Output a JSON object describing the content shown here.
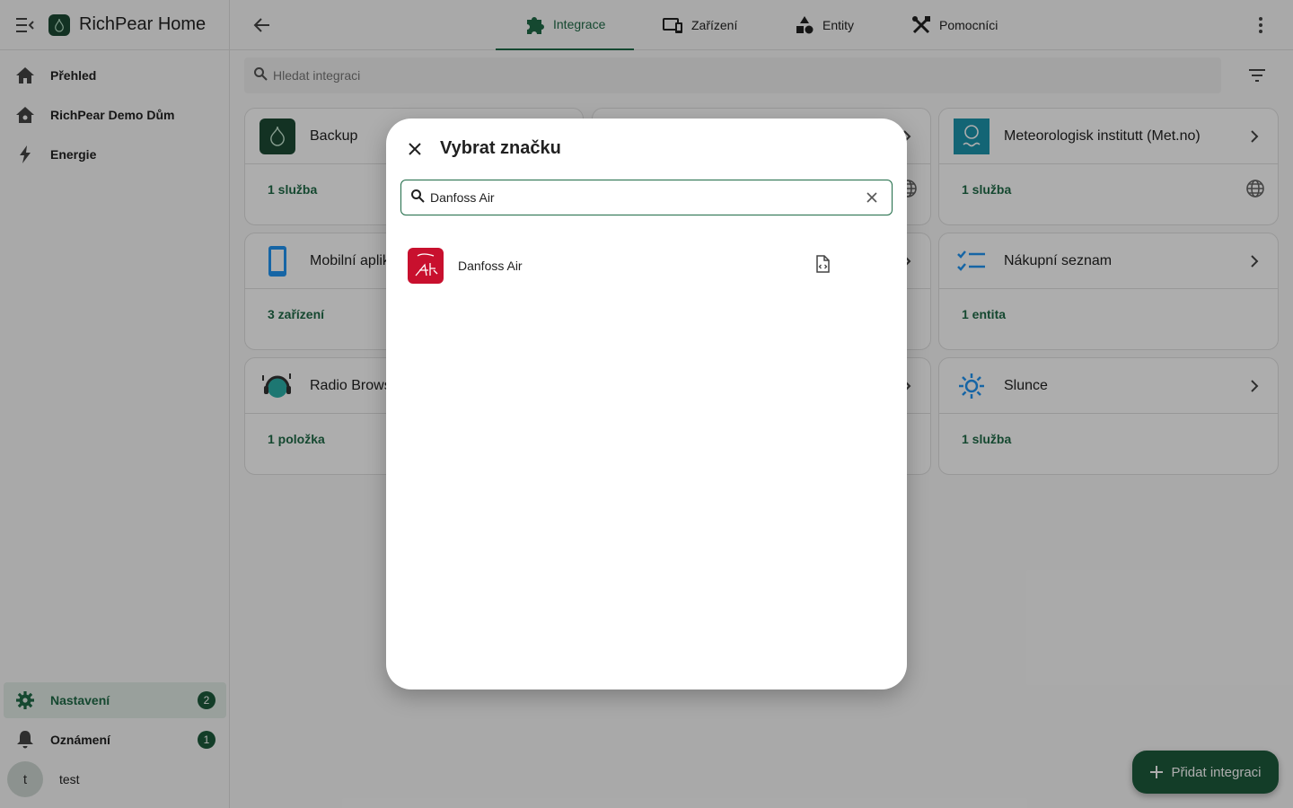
{
  "app": {
    "title": "RichPear Home"
  },
  "sidebar": {
    "items": [
      {
        "label": "Přehled"
      },
      {
        "label": "RichPear Demo Dům"
      },
      {
        "label": "Energie"
      }
    ],
    "settings": {
      "label": "Nastavení",
      "badge": "2"
    },
    "notifications": {
      "label": "Oznámení",
      "badge": "1"
    },
    "user": {
      "initial": "t",
      "name": "test"
    }
  },
  "tabs": [
    {
      "label": "Integrace"
    },
    {
      "label": "Zařízení"
    },
    {
      "label": "Entity"
    },
    {
      "label": "Pomocníci"
    }
  ],
  "search": {
    "placeholder": "Hledat integraci"
  },
  "cards": [
    {
      "name": "Backup",
      "footer": "1 služba"
    },
    {
      "name": "Meteorologisk institutt (Met.no)",
      "footer": "1 služba"
    },
    {
      "name": "Mobilní aplik",
      "footer": "3 zařízení"
    },
    {
      "name": "Nákupní seznam",
      "footer": "1 entita"
    },
    {
      "name": "Radio Brows",
      "footer": "1 položka"
    },
    {
      "name": "Slunce",
      "footer": "1 služba"
    }
  ],
  "dialog": {
    "title": "Vybrat značku",
    "search_value": "Danfoss Air",
    "results": [
      {
        "name": "Danfoss Air"
      }
    ]
  },
  "fab": {
    "label": "Přidat integraci"
  },
  "colors": {
    "primary": "#1f6b47",
    "dark": "#1c5a3c",
    "danfoss": "#c8102e",
    "metno": "#1c95ad"
  }
}
